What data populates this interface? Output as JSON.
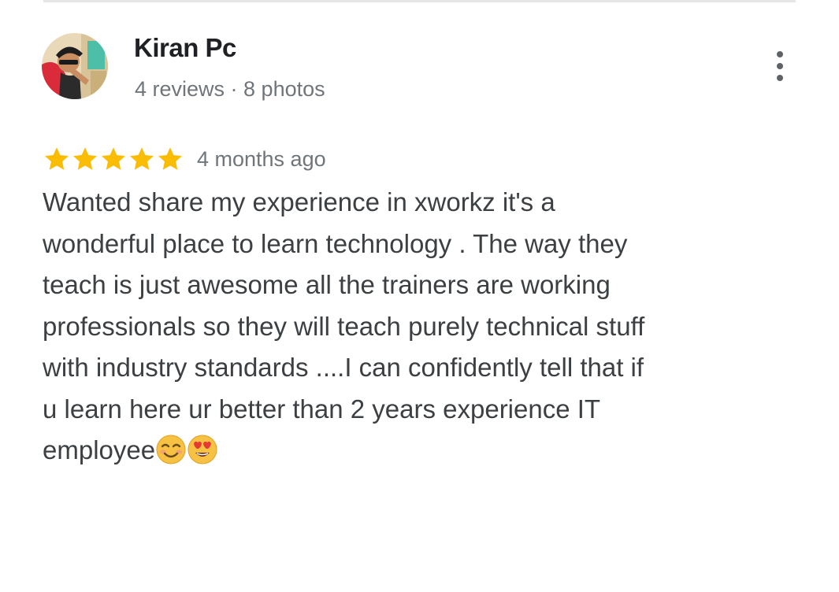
{
  "reviewer": {
    "name": "Kiran Pc",
    "meta": "4 reviews · 8 photos",
    "avatar_icon": "user-avatar-photo"
  },
  "menu": {
    "icon": "more-vertical-icon"
  },
  "review": {
    "rating": 5,
    "rating_max": 5,
    "star_color": "#fbbc04",
    "time_ago": "4 months ago",
    "text_lines": [
      "Wanted share my experience in xworkz it's a",
      "wonderful place to learn technology . The way they",
      "teach is just awesome all the trainers are working",
      "professionals so they will teach purely technical stuff",
      "with industry standards ....I can confidently tell that if",
      "u learn here ur better than 2 years experience IT",
      "employee"
    ],
    "emojis": [
      "smiling-face-emoji",
      "heart-eyes-emoji"
    ]
  }
}
